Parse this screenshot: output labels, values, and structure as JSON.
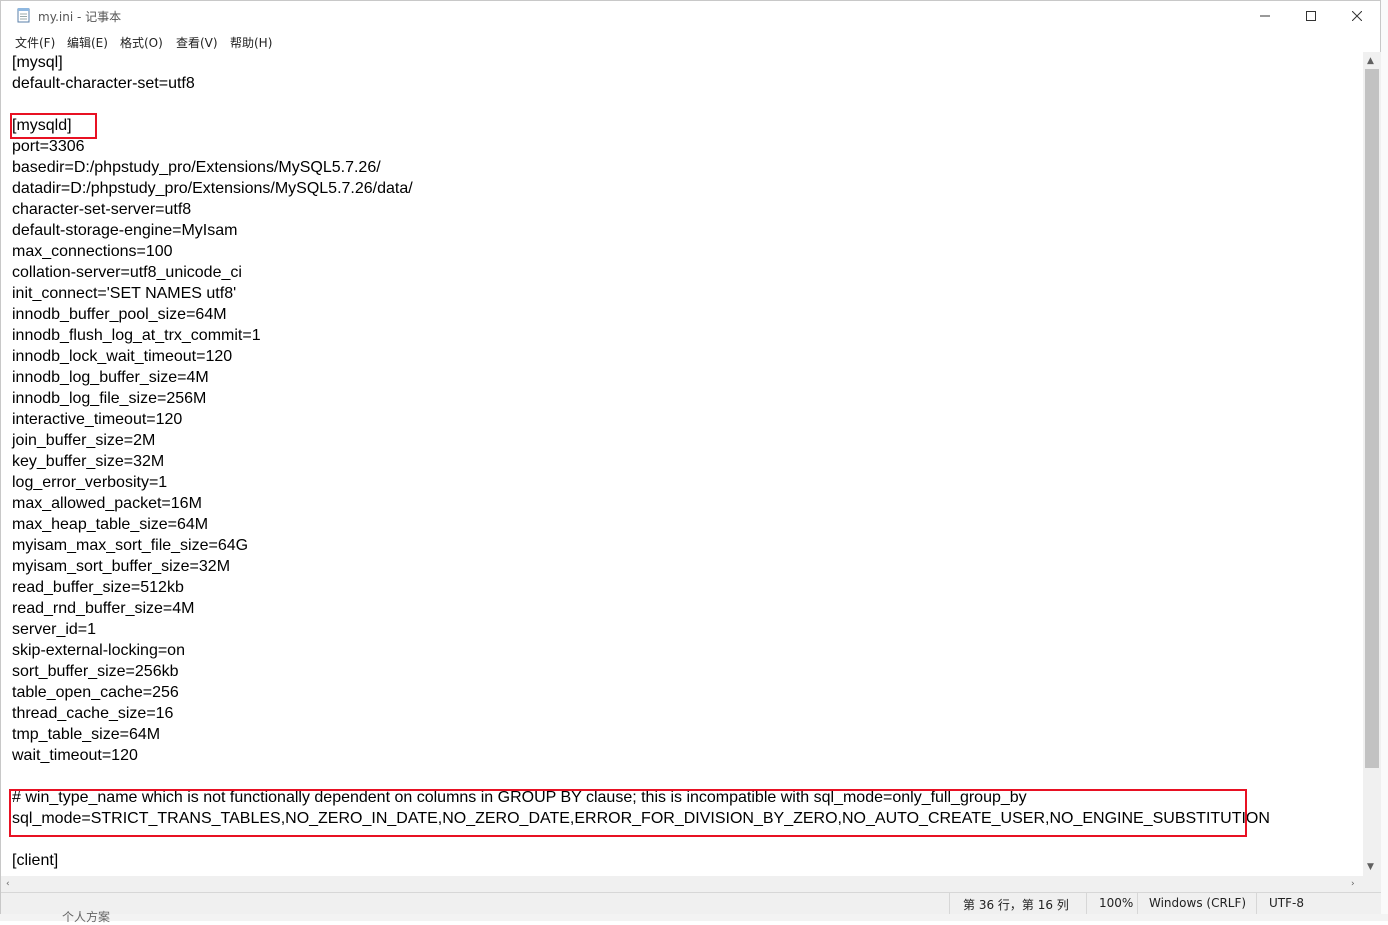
{
  "window": {
    "title": "my.ini - 记事本"
  },
  "menu": [
    "文件(F)",
    "编辑(E)",
    "格式(O)",
    "查看(V)",
    "帮助(H)"
  ],
  "editor": {
    "lines": [
      "[mysql]",
      "default-character-set=utf8",
      "",
      "[mysqld]",
      "port=3306",
      "basedir=D:/phpstudy_pro/Extensions/MySQL5.7.26/",
      "datadir=D:/phpstudy_pro/Extensions/MySQL5.7.26/data/",
      "character-set-server=utf8",
      "default-storage-engine=MyIsam",
      "max_connections=100",
      "collation-server=utf8_unicode_ci",
      "init_connect='SET NAMES utf8'",
      "innodb_buffer_pool_size=64M",
      "innodb_flush_log_at_trx_commit=1",
      "innodb_lock_wait_timeout=120",
      "innodb_log_buffer_size=4M",
      "innodb_log_file_size=256M",
      "interactive_timeout=120",
      "join_buffer_size=2M",
      "key_buffer_size=32M",
      "log_error_verbosity=1",
      "max_allowed_packet=16M",
      "max_heap_table_size=64M",
      "myisam_max_sort_file_size=64G",
      "myisam_sort_buffer_size=32M",
      "read_buffer_size=512kb",
      "read_rnd_buffer_size=4M",
      "server_id=1",
      "skip-external-locking=on",
      "sort_buffer_size=256kb",
      "table_open_cache=256",
      "thread_cache_size=16",
      "tmp_table_size=64M",
      "wait_timeout=120",
      "",
      "# win_type_name which is not functionally dependent on columns in GROUP BY clause; this is incompatible with sql_mode=only_full_group_by",
      "sql_mode=STRICT_TRANS_TABLES,NO_ZERO_IN_DATE,NO_ZERO_DATE,ERROR_FOR_DIVISION_BY_ZERO,NO_AUTO_CREATE_USER,NO_ENGINE_SUBSTITUTION",
      "",
      "[client]"
    ],
    "highlight_color": "#e81123"
  },
  "status": {
    "position": "第 36 行，第 16 列",
    "zoom": "100%",
    "line_ending": "Windows (CRLF)",
    "encoding": "UTF-8"
  },
  "background": {
    "partial_text": "个人方案"
  }
}
